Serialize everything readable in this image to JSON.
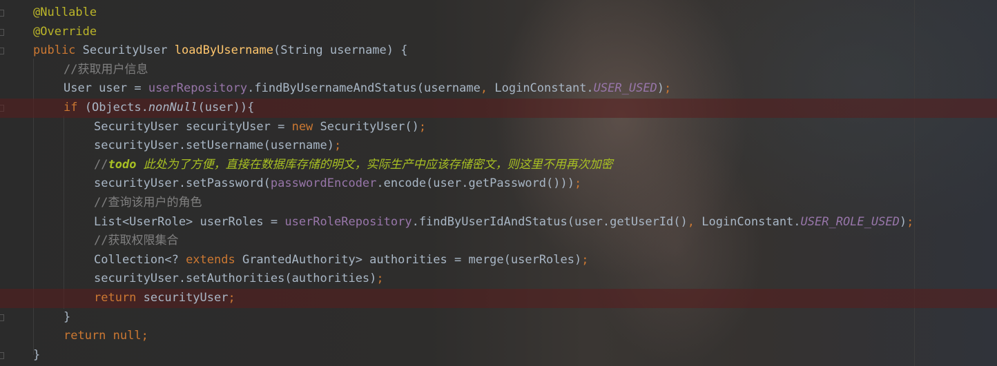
{
  "editor": {
    "language": "java",
    "lines": [
      [
        {
          "t": "@Nullable",
          "c": "ann"
        }
      ],
      [
        {
          "t": "@Override",
          "c": "ann"
        }
      ],
      [
        {
          "t": "public ",
          "c": "kw"
        },
        {
          "t": "SecurityUser ",
          "c": "dflt"
        },
        {
          "t": "loadByUsername",
          "c": "fn"
        },
        {
          "t": "(String username) {",
          "c": "dflt"
        }
      ],
      [
        {
          "t": "//获取用户信息",
          "c": "cmt"
        }
      ],
      [
        {
          "t": "User user = ",
          "c": "dflt"
        },
        {
          "t": "userRepository",
          "c": "fld"
        },
        {
          "t": ".findByUsernameAndStatus(username",
          "c": "dflt"
        },
        {
          "t": ", ",
          "c": "kw"
        },
        {
          "t": "LoginConstant.",
          "c": "dflt"
        },
        {
          "t": "USER_USED",
          "c": "cfld"
        },
        {
          "t": ")",
          "c": "dflt"
        },
        {
          "t": ";",
          "c": "kw"
        }
      ],
      [
        {
          "t": "if ",
          "c": "kw"
        },
        {
          "t": "(Objects.",
          "c": "dflt"
        },
        {
          "t": "nonNull",
          "c": "stat"
        },
        {
          "t": "(user)){",
          "c": "dflt"
        }
      ],
      [
        {
          "t": "SecurityUser securityUser = ",
          "c": "dflt"
        },
        {
          "t": "new ",
          "c": "kw"
        },
        {
          "t": "SecurityUser()",
          "c": "dflt"
        },
        {
          "t": ";",
          "c": "kw"
        }
      ],
      [
        {
          "t": "securityUser.setUsername(username)",
          "c": "dflt"
        },
        {
          "t": ";",
          "c": "kw"
        }
      ],
      [
        {
          "t": "//",
          "c": "cmt"
        },
        {
          "t": "todo",
          "c": "todo-b"
        },
        {
          "t": " 此处为了方便，直接在数据库存储的明文，实际生产中应该存储密文，则这里不用再次加密",
          "c": "todo"
        }
      ],
      [
        {
          "t": "securityUser.setPassword(",
          "c": "dflt"
        },
        {
          "t": "passwordEncoder",
          "c": "fld"
        },
        {
          "t": ".encode(user.getPassword()))",
          "c": "dflt"
        },
        {
          "t": ";",
          "c": "kw"
        }
      ],
      [
        {
          "t": "//查询该用户的角色",
          "c": "cmt"
        }
      ],
      [
        {
          "t": "List<UserRole> userRoles = ",
          "c": "dflt"
        },
        {
          "t": "userRoleRepository",
          "c": "fld"
        },
        {
          "t": ".findByUserIdAndStatus(user.getUserId()",
          "c": "dflt"
        },
        {
          "t": ", ",
          "c": "kw"
        },
        {
          "t": "LoginConstant.",
          "c": "dflt"
        },
        {
          "t": "USER_ROLE_USED",
          "c": "cfld"
        },
        {
          "t": ")",
          "c": "dflt"
        },
        {
          "t": ";",
          "c": "kw"
        }
      ],
      [
        {
          "t": "//获取权限集合",
          "c": "cmt"
        }
      ],
      [
        {
          "t": "Collection<? ",
          "c": "dflt"
        },
        {
          "t": "extends ",
          "c": "kw"
        },
        {
          "t": "GrantedAuthority> authorities = merge(userRoles)",
          "c": "dflt"
        },
        {
          "t": ";",
          "c": "kw"
        }
      ],
      [
        {
          "t": "securityUser.setAuthorities(authorities)",
          "c": "dflt"
        },
        {
          "t": ";",
          "c": "kw"
        }
      ],
      [
        {
          "t": "return ",
          "c": "kw"
        },
        {
          "t": "securityUser",
          "c": "dflt"
        },
        {
          "t": ";",
          "c": "kw"
        }
      ],
      [
        {
          "t": "}",
          "c": "dflt"
        }
      ],
      [
        {
          "t": "return null",
          "c": "kw"
        },
        {
          "t": ";",
          "c": "kw"
        }
      ],
      [
        {
          "t": "}",
          "c": "dflt"
        }
      ]
    ]
  },
  "colors": {
    "background": "#2b2b2b",
    "keyword": "#cc7832",
    "annotation": "#bbb529",
    "method": "#ffc66d",
    "field": "#9876aa",
    "comment": "#808080",
    "todo": "#a8c023",
    "text": "#a9b7c6",
    "breakpoint_line": "#5a1e1e"
  }
}
